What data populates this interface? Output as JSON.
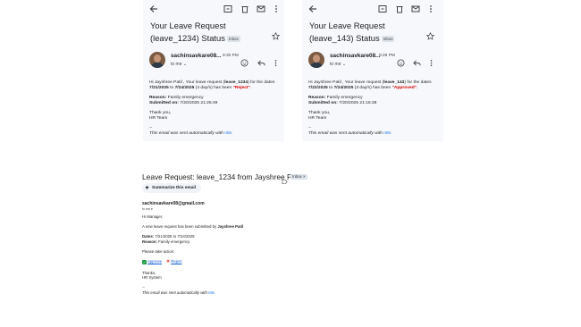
{
  "card1": {
    "subject": "Your Leave Request (leave_1234) Status",
    "badge": "Inbox",
    "sender": "sachinsavkare08...",
    "time": "9:30 PM",
    "to": "to me",
    "greeting_pre": "Hi Jayshree Patil , Your leave request (",
    "req_id": "leave_1234",
    "greeting_mid": ") for the dates ",
    "from_date": "7/21/2025",
    "to_word": " to ",
    "to_date": "7/24/2025",
    "days": " (4 day/s) has been ",
    "status": "\"Reject\"",
    "status_end": ".",
    "reason_label": "Reason:",
    "reason": " Family emergency",
    "submitted_label": "Submitted on:",
    "submitted": " 7/20/2025 21:25:49",
    "thanks": "Thank you,",
    "team": "HR Team",
    "dashes": "--",
    "auto_pre": "This email was sent automatically with ",
    "auto_link": "n8n"
  },
  "card2": {
    "subject": "Your Leave Request (leave_143) Status",
    "badge": "Inbox",
    "sender": "sachinsavkare08...",
    "time": "9:28 PM",
    "to": "to me",
    "greeting_pre": "Hi Jayshree Patil , Your leave request (",
    "req_id": "leave_143",
    "greeting_mid": ") for the dates ",
    "from_date": "7/22/2025",
    "to_word": " to ",
    "to_date": "7/24/2025",
    "days": " (3 day/s) has been ",
    "status": "\"Approved\"",
    "status_end": ".",
    "reason_label": "Reason:",
    "reason": " Family emergency",
    "submitted_label": "Submitted on:",
    "submitted": " 7/20/2025 21:16:28",
    "thanks": "Thank you,",
    "team": "HR Team",
    "dashes": "--",
    "auto_pre": "This email was sent automatically with ",
    "auto_link": "n8n"
  },
  "bottom": {
    "title": "Leave Request: leave_1234 from Jayshree Patil",
    "badge": "Inbox ×",
    "summarize": "Summarize this email",
    "sender": "sachinsavkare08@gmail.com",
    "to": "to me ▾",
    "hi": "Hi Manager,",
    "line1_pre": "A new leave request has been submitted by ",
    "line1_name": "Jayshree Patil",
    "dates_label": "Dates:",
    "dates": " 7/21/2025 to 7/24/2025",
    "reason_label": "Reason:",
    "reason": " Family emergency",
    "action": "Please take action:",
    "approve": "Approve",
    "reject": "Reject",
    "thanks": "Thanks,",
    "system": "HR System",
    "dashes": "--",
    "auto_pre": "This email was sent automatically with ",
    "auto_link": "n8n"
  },
  "colors": {
    "rejected": "#d90000",
    "link": "#1a73e8",
    "card_bg": "#f6f8fc"
  }
}
